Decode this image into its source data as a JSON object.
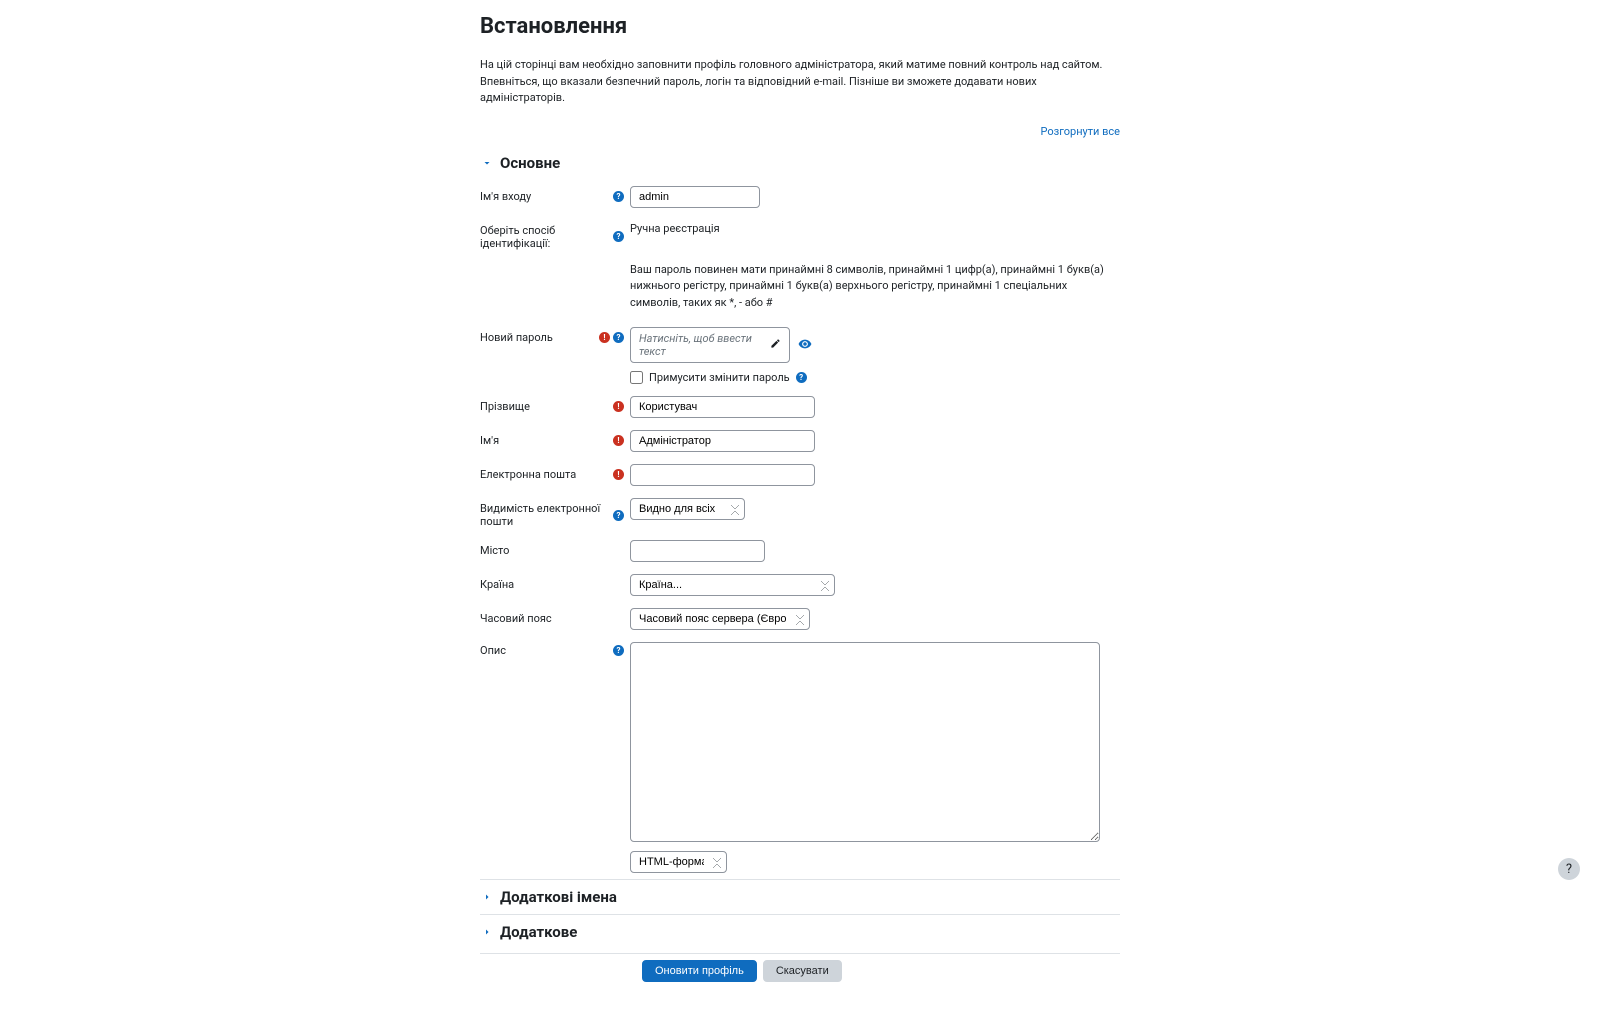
{
  "page": {
    "title": "Встановлення",
    "intro": "На цій сторінці вам необхідно заповнити профіль головного адміністратора, який матиме повний контроль над сайтом. Впевніться, що вказали безпечний пароль, логін та відповідний e-mail. Пізніше ви зможете додавати нових адміністраторів.",
    "expand_all": "Розгорнути все"
  },
  "sections": {
    "main": "Основне",
    "extra_names": "Додаткові імена",
    "extra": "Додаткове"
  },
  "labels": {
    "username": "Ім'я входу",
    "auth": "Оберіть спосіб ідентифікації:",
    "new_password": "Новий пароль",
    "force_change": "Примусити змінити пароль",
    "lastname": "Прізвище",
    "firstname": "Ім'я",
    "email": "Електронна пошта",
    "email_vis": "Видимість електронної пошти",
    "city": "Місто",
    "country": "Країна",
    "timezone": "Часовий пояс",
    "description": "Опис"
  },
  "values": {
    "username": "admin",
    "auth": "Ручна реєстрація",
    "password_placeholder": "Натисніть, щоб ввести текст",
    "lastname": "Користувач",
    "firstname": "Адміністратор",
    "email": "",
    "email_vis": "Видно для всіх",
    "city": "",
    "country": "Країна...",
    "timezone": "Часовий пояс сервера (Європа/Лондон)",
    "format": "HTML-формат",
    "password_hint": "Ваш пароль повинен мати принаймні 8 символів, принаймні 1 цифр(а), принаймні 1 букв(а) нижнього регістру, принаймні 1 букв(а) верхнього регістру, принаймні 1 спеціальних символів, таких як *, - або #"
  },
  "buttons": {
    "submit": "Оновити профіль",
    "cancel": "Скасувати"
  },
  "glyphs": {
    "req": "!",
    "hlp": "?",
    "help_fab": "?"
  }
}
